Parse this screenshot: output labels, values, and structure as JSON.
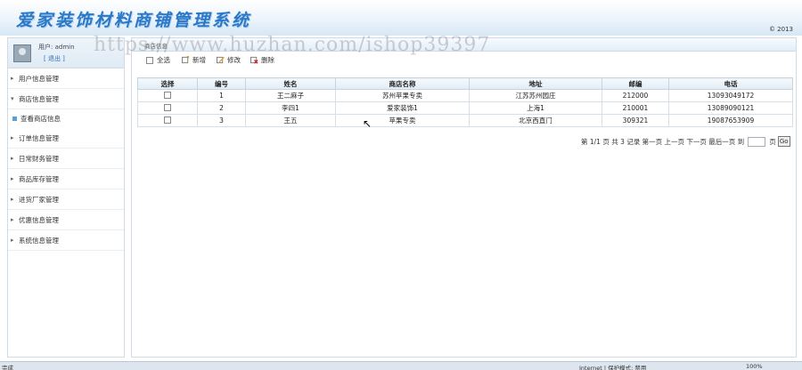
{
  "header": {
    "app_title": "爱家装饰材料商铺管理系统",
    "copyright": "© 2013",
    "watermark": "https://www.huzhan.com/ishop39397"
  },
  "sidebar": {
    "user_name": "用户: admin",
    "logout": "[ 退出 ]",
    "items": [
      {
        "label": "用户信息管理",
        "arrow": "▸"
      },
      {
        "label": "商店信息管理",
        "arrow": "▾"
      },
      {
        "label": "订单信息管理",
        "arrow": "▸"
      },
      {
        "label": "日常财务管理",
        "arrow": "▸"
      },
      {
        "label": "商品库存管理",
        "arrow": "▸"
      },
      {
        "label": "进货厂家管理",
        "arrow": "▸"
      },
      {
        "label": "优惠信息管理",
        "arrow": "▸"
      },
      {
        "label": "系统信息管理",
        "arrow": "▸"
      }
    ],
    "sub_item": "查看商店信息"
  },
  "main": {
    "tab_label": "商店信息",
    "toolbar": {
      "select_all": "全选",
      "add": "新增",
      "edit": "修改",
      "delete": "删除"
    },
    "table": {
      "columns": [
        "选择",
        "编号",
        "姓名",
        "商店名称",
        "地址",
        "邮编",
        "电话"
      ],
      "rows": [
        {
          "id": "1",
          "name": "王二麻子",
          "shop": "苏州苹果专卖",
          "address": "江苏苏州园庄",
          "zip": "212000",
          "phone": "13093049172"
        },
        {
          "id": "2",
          "name": "李四1",
          "shop": "爱家装饰1",
          "address": "上海1",
          "zip": "210001",
          "phone": "13089090121"
        },
        {
          "id": "3",
          "name": "王五",
          "shop": "苹果专卖",
          "address": "北京西直门",
          "zip": "309321",
          "phone": "19087653909"
        }
      ]
    },
    "pager": {
      "text": "第 1/1 页 共 3 记录 第一页 上一页 下一页 最后一页 到",
      "page_suffix": "页",
      "go": "Go"
    }
  },
  "statusbar": {
    "left": "完成",
    "mid": "Internet | 保护模式: 禁用",
    "zoom": "100%"
  },
  "colors": {
    "title_blue": "#2a78c8",
    "header_bg": "#d6e7f5",
    "border": "#cfdbe6"
  }
}
